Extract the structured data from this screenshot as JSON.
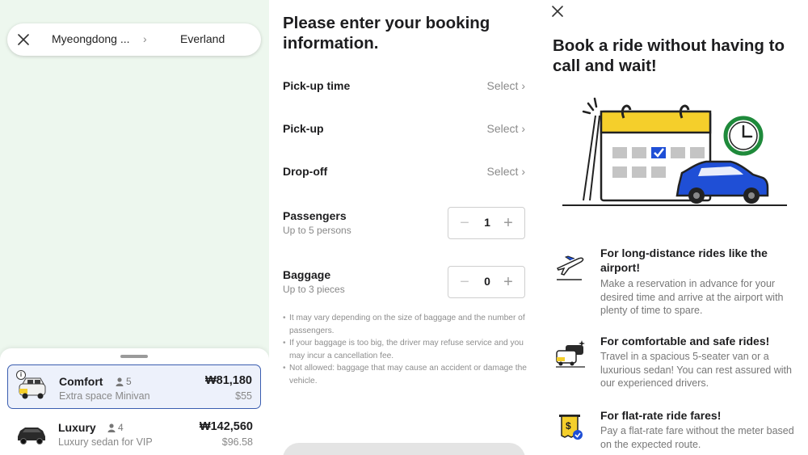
{
  "route": {
    "from": "Myeongdong ...",
    "to": "Everland"
  },
  "rides": [
    {
      "name": "Comfort",
      "capacity": "5",
      "description": "Extra space Minivan",
      "price": "₩81,180",
      "usd": "$55",
      "info": "i"
    },
    {
      "name": "Luxury",
      "capacity": "4",
      "description": "Luxury sedan for VIP",
      "price": "₩142,560",
      "usd": "$96.58"
    }
  ],
  "booking": {
    "title": "Please enter your booking information.",
    "fields": [
      {
        "label": "Pick-up time",
        "value": "Select"
      },
      {
        "label": "Pick-up",
        "value": "Select"
      },
      {
        "label": "Drop-off",
        "value": "Select"
      }
    ],
    "passengers": {
      "label": "Passengers",
      "sub": "Up to 5 persons",
      "value": "1"
    },
    "baggage": {
      "label": "Baggage",
      "sub": "Up to 3 pieces",
      "value": "0"
    },
    "notes": [
      "It may vary depending on the size of baggage and the number of passengers.",
      "If your baggage is too big, the driver may refuse service and you may incur a cancellation fee.",
      "Not allowed: baggage that may cause an accident or damage the vehicle."
    ]
  },
  "promo": {
    "title": "Book a ride without having to call and wait!",
    "features": [
      {
        "icon": "airplane-icon",
        "title": "For long-distance rides like the airport!",
        "body": "Make a reservation in advance for your desired time and arrive at the airport with plenty of time to spare."
      },
      {
        "icon": "van-icon",
        "title": "For comfortable and safe rides!",
        "body": "Travel in a spacious 5-seater van or a luxurious sedan! You can rest assured with our experienced drivers."
      },
      {
        "icon": "receipt-icon",
        "title": "For flat-rate ride fares!",
        "body": "Pay a flat-rate fare without the meter based on the expected route."
      }
    ]
  },
  "colors": {
    "map_bg": "#edf7ee",
    "selected_border": "#3a5db0",
    "selected_bg": "#edf1fb",
    "calendar_yellow": "#f5cf2b",
    "car_blue": "#1f4fd6",
    "clock_green": "#1f8a3b"
  }
}
